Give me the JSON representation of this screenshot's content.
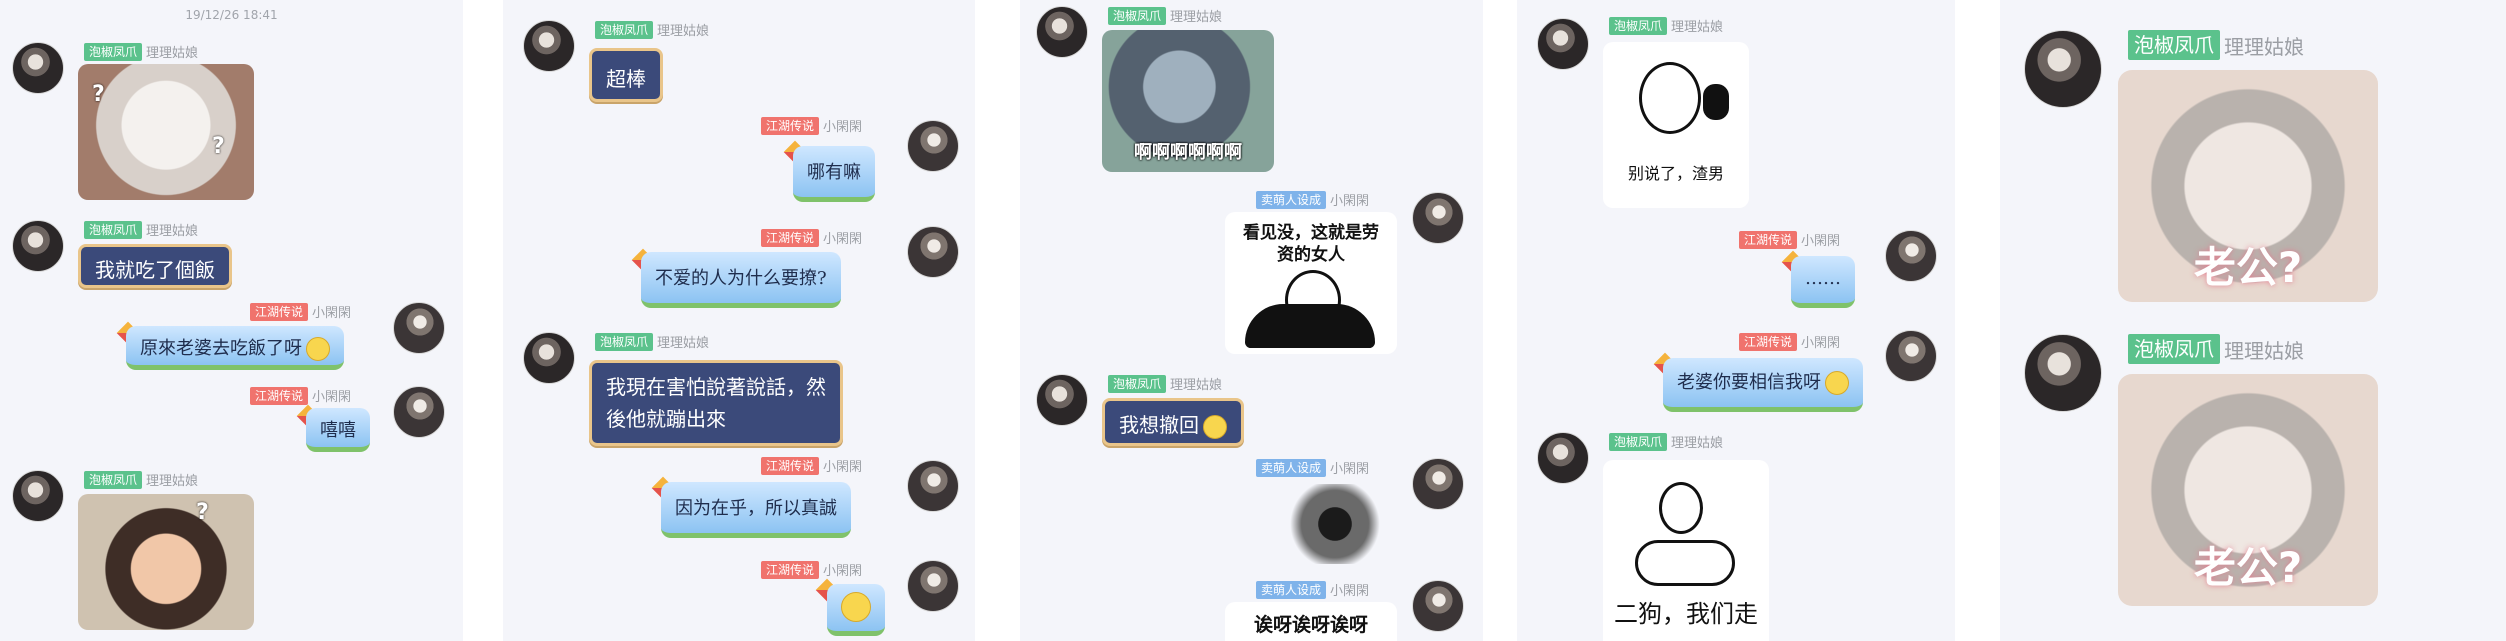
{
  "panel1": {
    "timestamp": "19/12/26 18:41",
    "nick_a": "泡椒凤爪",
    "nick_a_sub": "理理姑娘",
    "nick_b": "江湖传说",
    "nick_b_sub": "小閑閑",
    "msg_1": "我就吃了個飯",
    "msg_2": "原來老婆去吃飯了呀",
    "msg_3": "嘻嘻"
  },
  "panel2": {
    "nick_a": "泡椒凤爪",
    "nick_a_sub": "理理姑娘",
    "nick_b": "江湖传说",
    "nick_b_sub": "小閑閑",
    "msg_1": "超棒",
    "msg_2": "哪有嘛",
    "msg_3": "不爱的人为什么要撩?",
    "msg_4_line1": "我現在害怕說著說話，然",
    "msg_4_line2": "後他就蹦出來",
    "msg_5": "因为在乎，所以真誠"
  },
  "panel3": {
    "nick_a": "泡椒凤爪",
    "nick_a_sub": "理理姑娘",
    "nick_c": "卖萌人设成",
    "nick_c_sub": "小閑閑",
    "sticker_tom": "啊啊啊啊啊啊",
    "sticker_panda_line1": "看见没，这就是劳",
    "sticker_panda_line2": "资的女人",
    "msg_1": "我想撤回",
    "sticker_last": "诶呀诶呀诶呀"
  },
  "panel4": {
    "nick_a": "泡椒凤爪",
    "nick_a_sub": "理理姑娘",
    "nick_b": "江湖传说",
    "nick_b_sub": "小閑閑",
    "sticker_1": "别说了，渣男",
    "msg_1": "……",
    "msg_2": "老婆你要相信我呀",
    "sticker_2": "二狗，我们走"
  },
  "panel5": {
    "nick_a": "泡椒凤爪",
    "nick_a_sub": "理理姑娘",
    "sticker_caption": "老公?"
  },
  "colors": {
    "panel_bg": "#f4f5fa",
    "tag_green": "#5bc28c",
    "tag_red": "#f0736d",
    "tag_blue": "#7fb3ea",
    "bubble_dark": "#3b4a7a",
    "bubble_border": "#e9c58a",
    "bubble_sky": "#8cc3f2"
  }
}
